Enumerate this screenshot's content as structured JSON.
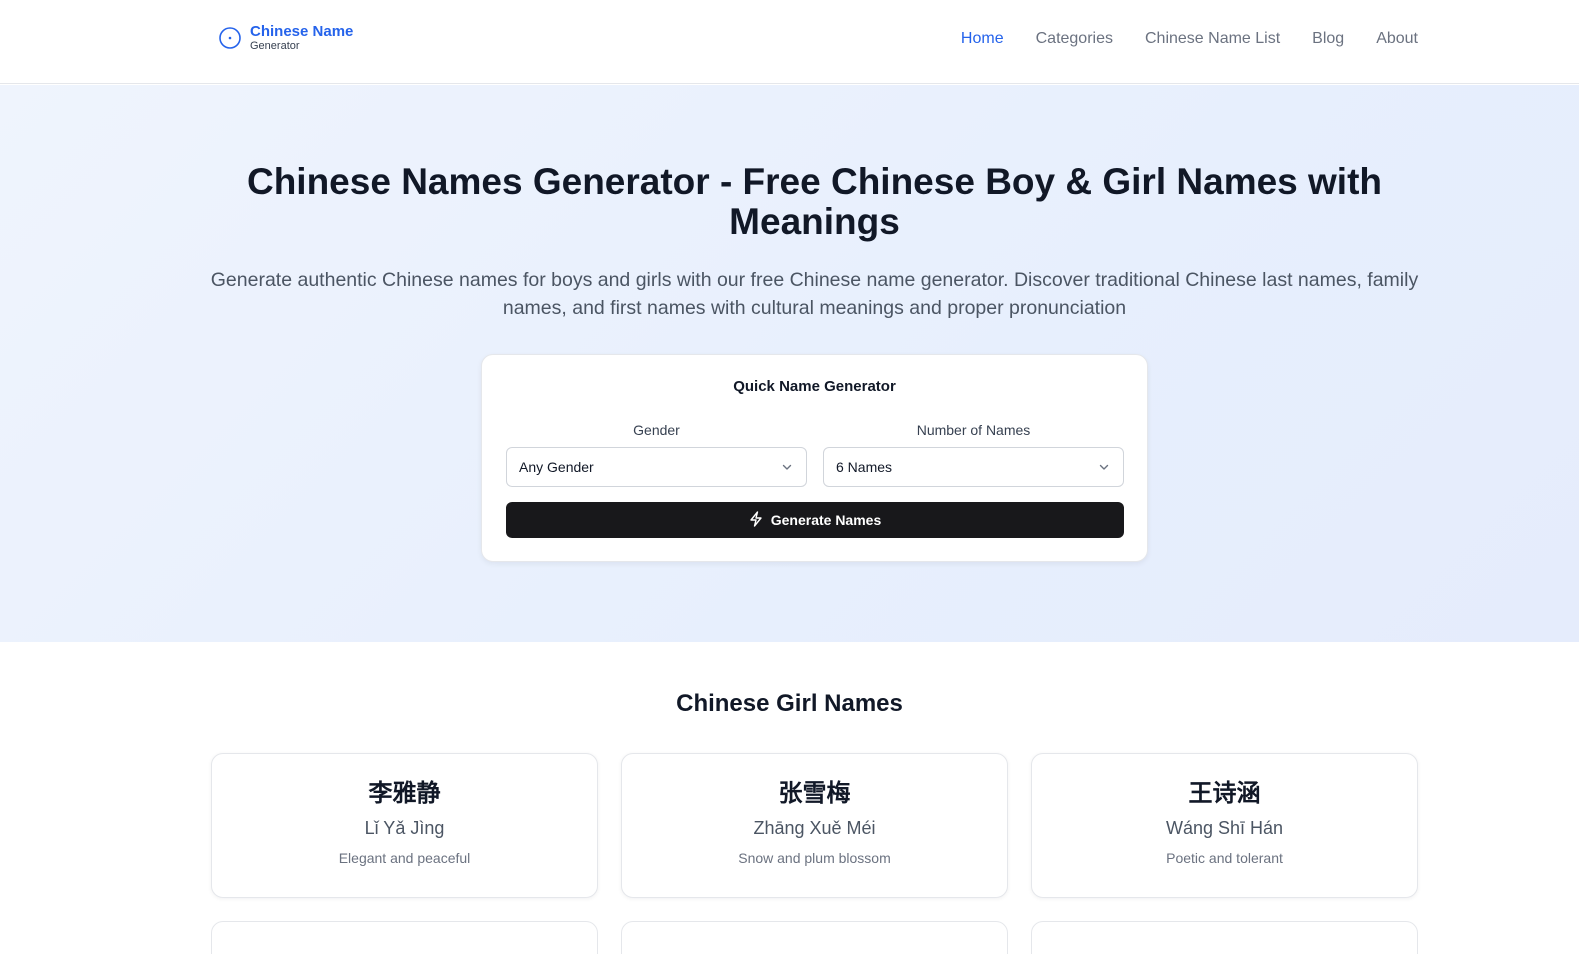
{
  "header": {
    "logo_title": "Chinese Name",
    "logo_sub": "Generator",
    "nav": [
      {
        "label": "Home",
        "active": true
      },
      {
        "label": "Categories",
        "active": false
      },
      {
        "label": "Chinese Name List",
        "active": false
      },
      {
        "label": "Blog",
        "active": false
      },
      {
        "label": "About",
        "active": false
      }
    ]
  },
  "hero": {
    "title": "Chinese Names Generator - Free Chinese Boy & Girl Names with Meanings",
    "description": "Generate authentic Chinese names for boys and girls with our free Chinese name generator. Discover traditional Chinese last names, family names, and first names with cultural meanings and proper pronunciation"
  },
  "generator": {
    "title": "Quick Name Generator",
    "gender_label": "Gender",
    "gender_value": "Any Gender",
    "count_label": "Number of Names",
    "count_value": "6 Names",
    "button_label": "Generate Names",
    "button_icon": "lightning-icon"
  },
  "girls": {
    "title": "Chinese Girl Names",
    "names": [
      {
        "chinese": "李雅静",
        "pinyin": "Lǐ Yǎ Jìng",
        "meaning": "Elegant and peaceful"
      },
      {
        "chinese": "张雪梅",
        "pinyin": "Zhāng Xuě Méi",
        "meaning": "Snow and plum blossom"
      },
      {
        "chinese": "王诗涵",
        "pinyin": "Wáng Shī Hán",
        "meaning": "Poetic and tolerant"
      }
    ]
  },
  "colors": {
    "accent": "#2563eb",
    "button": "#18181b",
    "hero_bg": "#eaf1fd"
  }
}
